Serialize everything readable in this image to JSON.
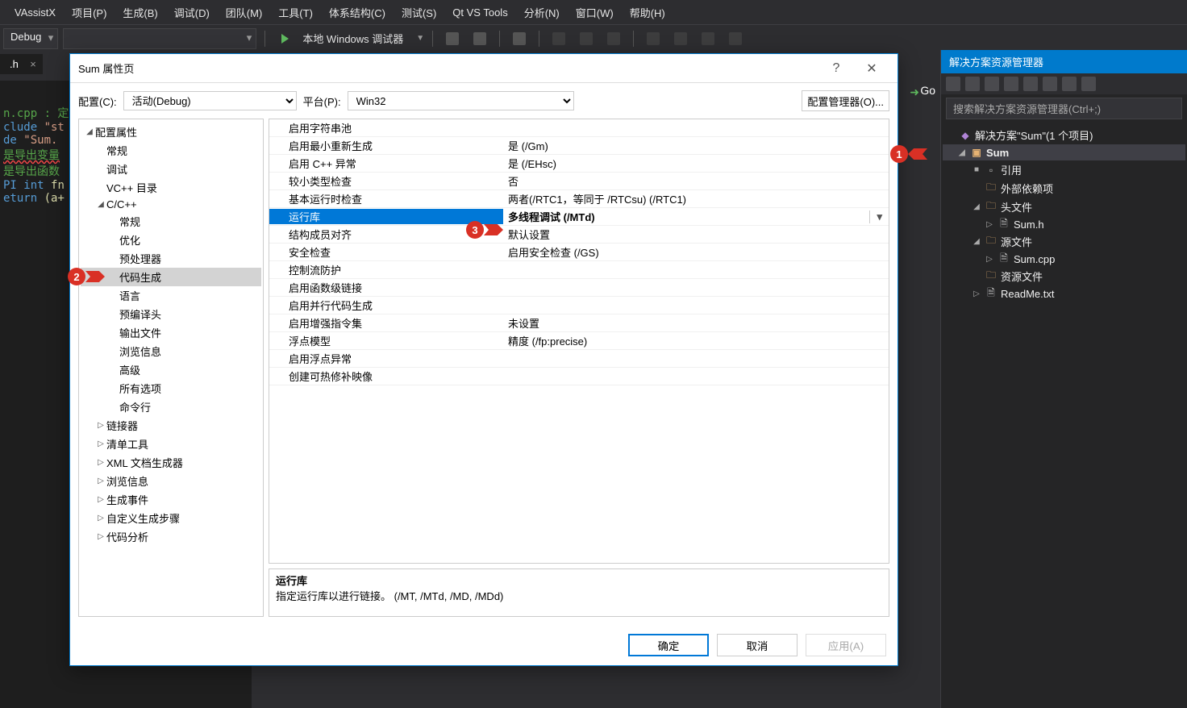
{
  "menubar": {
    "items": [
      "VAssistX",
      "项目(P)",
      "生成(B)",
      "调试(D)",
      "团队(M)",
      "工具(T)",
      "体系结构(C)",
      "测试(S)",
      "Qt VS Tools",
      "分析(N)",
      "窗口(W)",
      "帮助(H)"
    ]
  },
  "toolbar": {
    "config": "Debug",
    "debugger_label": "本地 Windows 调试器"
  },
  "editor": {
    "tab": ".h",
    "lines": [
      "n.cpp : 定",
      "",
      "clude \"st",
      "de \"Sum.",
      "",
      "是导出变量",
      "",
      "是导出函数",
      "PI int fn",
      "",
      "eturn (a+"
    ],
    "go_label": "Go"
  },
  "solution": {
    "panel_title": "解决方案资源管理器",
    "search_placeholder": "搜索解决方案资源管理器(Ctrl+;)",
    "root": "解决方案\"Sum\"(1 个项目)",
    "project": "Sum",
    "items": [
      {
        "icon": "ref",
        "label": "引用",
        "indent": 2,
        "arrow": "■"
      },
      {
        "icon": "folder",
        "label": "外部依赖项",
        "indent": 2,
        "arrow": ""
      },
      {
        "icon": "folder",
        "label": "头文件",
        "indent": 2,
        "arrow": "◢"
      },
      {
        "icon": "file",
        "label": "Sum.h",
        "indent": 3,
        "arrow": "▷"
      },
      {
        "icon": "folder",
        "label": "源文件",
        "indent": 2,
        "arrow": "◢"
      },
      {
        "icon": "file",
        "label": "Sum.cpp",
        "indent": 3,
        "arrow": "▷"
      },
      {
        "icon": "folder",
        "label": "资源文件",
        "indent": 2,
        "arrow": ""
      },
      {
        "icon": "file",
        "label": "ReadMe.txt",
        "indent": 2,
        "arrow": "▷"
      }
    ]
  },
  "dialog": {
    "title": "Sum 属性页",
    "config_label": "配置(C):",
    "config_value": "活动(Debug)",
    "platform_label": "平台(P):",
    "platform_value": "Win32",
    "config_mgr": "配置管理器(O)...",
    "tree": [
      {
        "label": "配置属性",
        "indent": 0,
        "arrow": "◢"
      },
      {
        "label": "常规",
        "indent": 1,
        "arrow": ""
      },
      {
        "label": "调试",
        "indent": 1,
        "arrow": ""
      },
      {
        "label": "VC++ 目录",
        "indent": 1,
        "arrow": ""
      },
      {
        "label": "C/C++",
        "indent": 1,
        "arrow": "◢"
      },
      {
        "label": "常规",
        "indent": 2,
        "arrow": ""
      },
      {
        "label": "优化",
        "indent": 2,
        "arrow": ""
      },
      {
        "label": "预处理器",
        "indent": 2,
        "arrow": ""
      },
      {
        "label": "代码生成",
        "indent": 2,
        "arrow": "",
        "selected": true
      },
      {
        "label": "语言",
        "indent": 2,
        "arrow": ""
      },
      {
        "label": "预编译头",
        "indent": 2,
        "arrow": ""
      },
      {
        "label": "输出文件",
        "indent": 2,
        "arrow": ""
      },
      {
        "label": "浏览信息",
        "indent": 2,
        "arrow": ""
      },
      {
        "label": "高级",
        "indent": 2,
        "arrow": ""
      },
      {
        "label": "所有选项",
        "indent": 2,
        "arrow": ""
      },
      {
        "label": "命令行",
        "indent": 2,
        "arrow": ""
      },
      {
        "label": "链接器",
        "indent": 1,
        "arrow": "▷"
      },
      {
        "label": "清单工具",
        "indent": 1,
        "arrow": "▷"
      },
      {
        "label": "XML 文档生成器",
        "indent": 1,
        "arrow": "▷"
      },
      {
        "label": "浏览信息",
        "indent": 1,
        "arrow": "▷"
      },
      {
        "label": "生成事件",
        "indent": 1,
        "arrow": "▷"
      },
      {
        "label": "自定义生成步骤",
        "indent": 1,
        "arrow": "▷"
      },
      {
        "label": "代码分析",
        "indent": 1,
        "arrow": "▷"
      }
    ],
    "props": [
      {
        "key": "启用字符串池",
        "val": ""
      },
      {
        "key": "启用最小重新生成",
        "val": "是 (/Gm)"
      },
      {
        "key": "启用 C++ 异常",
        "val": "是 (/EHsc)"
      },
      {
        "key": "较小类型检查",
        "val": "否"
      },
      {
        "key": "基本运行时检查",
        "val": "两者(/RTC1，等同于 /RTCsu) (/RTC1)"
      },
      {
        "key": "运行库",
        "val": "多线程调试 (/MTd)",
        "selected": true
      },
      {
        "key": "结构成员对齐",
        "val": "默认设置"
      },
      {
        "key": "安全检查",
        "val": "启用安全检查 (/GS)"
      },
      {
        "key": "控制流防护",
        "val": ""
      },
      {
        "key": "启用函数级链接",
        "val": ""
      },
      {
        "key": "启用并行代码生成",
        "val": ""
      },
      {
        "key": "启用增强指令集",
        "val": "未设置"
      },
      {
        "key": "浮点模型",
        "val": "精度 (/fp:precise)"
      },
      {
        "key": "启用浮点异常",
        "val": ""
      },
      {
        "key": "创建可热修补映像",
        "val": ""
      }
    ],
    "desc_title": "运行库",
    "desc_body": "指定运行库以进行链接。     (/MT, /MTd, /MD, /MDd)",
    "btn_ok": "确定",
    "btn_cancel": "取消",
    "btn_apply": "应用(A)"
  },
  "annotations": {
    "a1": "1",
    "a2": "2",
    "a3": "3"
  }
}
